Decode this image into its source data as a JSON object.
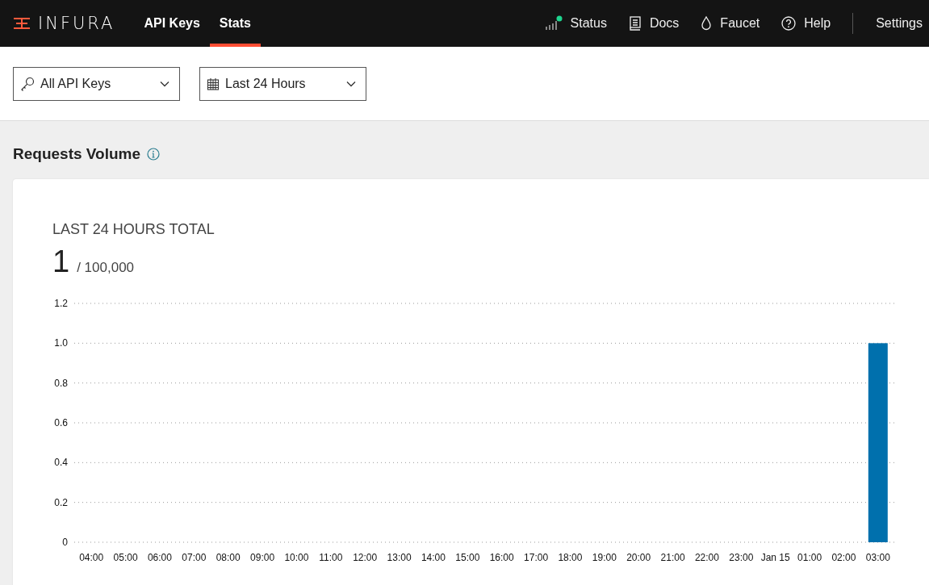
{
  "header": {
    "logo": "INFURA",
    "tabs": [
      {
        "label": "API Keys",
        "selected": false
      },
      {
        "label": "Stats",
        "selected": true
      }
    ],
    "links": [
      {
        "kind": "status",
        "label": "Status"
      },
      {
        "kind": "docs",
        "label": "Docs"
      },
      {
        "kind": "faucet",
        "label": "Faucet"
      },
      {
        "kind": "help",
        "label": "Help"
      },
      {
        "kind": "settings",
        "label": "Settings"
      }
    ]
  },
  "filters": [
    {
      "kind": "key",
      "value": "All API Keys"
    },
    {
      "kind": "calendar",
      "value": "Last 24 Hours"
    }
  ],
  "section": {
    "title": "Requests Volume",
    "card": {
      "label": "LAST 24 HOURS TOTAL",
      "total": "1",
      "limit": "/ 100,000",
      "chart_data": {
        "type": "bar",
        "categories": [
          "04:00",
          "05:00",
          "06:00",
          "07:00",
          "08:00",
          "09:00",
          "10:00",
          "11:00",
          "12:00",
          "13:00",
          "14:00",
          "15:00",
          "16:00",
          "17:00",
          "18:00",
          "19:00",
          "20:00",
          "21:00",
          "22:00",
          "23:00",
          "Jan 15",
          "01:00",
          "02:00",
          "03:00"
        ],
        "grid": true,
        "series": [
          {
            "color": "#0070ad",
            "values": [
              0,
              0,
              0,
              0,
              0,
              0,
              0,
              0,
              0,
              0,
              0,
              0,
              0,
              0,
              0,
              0,
              0,
              0,
              0,
              0,
              0,
              0,
              0,
              1
            ]
          }
        ],
        "ylim": [
          0,
          1.2
        ],
        "yticks": [
          {
            "value": 0,
            "label": "0"
          },
          {
            "value": 0.2,
            "label": "0.2"
          },
          {
            "value": 0.4,
            "label": "0.4"
          },
          {
            "value": 0.6,
            "label": "0.6"
          },
          {
            "value": 0.8,
            "label": "0.8"
          },
          {
            "value": 1,
            "label": "1.0"
          },
          {
            "value": 1.2,
            "label": "1.2"
          }
        ]
      }
    }
  }
}
